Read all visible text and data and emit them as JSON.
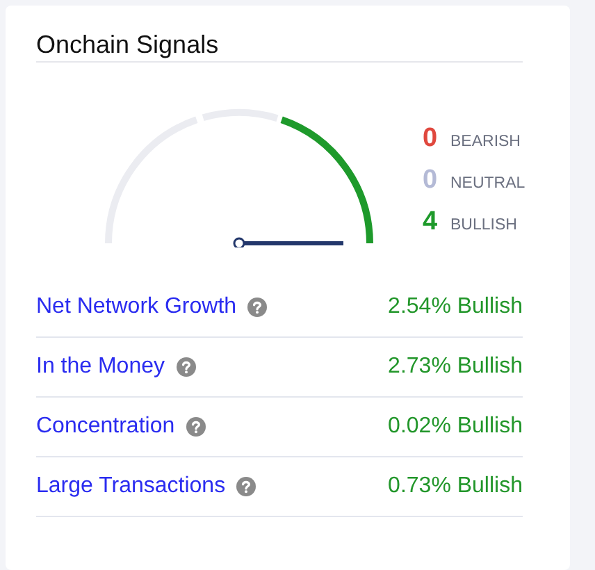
{
  "card": {
    "title": "Onchain Signals"
  },
  "gauge": {
    "segments": [
      {
        "selected": false
      },
      {
        "selected": false
      },
      {
        "selected": true
      }
    ]
  },
  "legend": [
    {
      "count": "0",
      "label": "BEARISH",
      "color": "#e0483e"
    },
    {
      "count": "0",
      "label": "NEUTRAL",
      "color": "#b4bad6"
    },
    {
      "count": "4",
      "label": "BULLISH",
      "color": "#1e9a2b"
    }
  ],
  "signals": [
    {
      "name": "Net Network Growth",
      "value": "2.54% Bullish"
    },
    {
      "name": "In the Money",
      "value": "2.73% Bullish"
    },
    {
      "name": "Concentration",
      "value": "0.02% Bullish"
    },
    {
      "name": "Large Transactions",
      "value": "0.73% Bullish"
    }
  ]
}
